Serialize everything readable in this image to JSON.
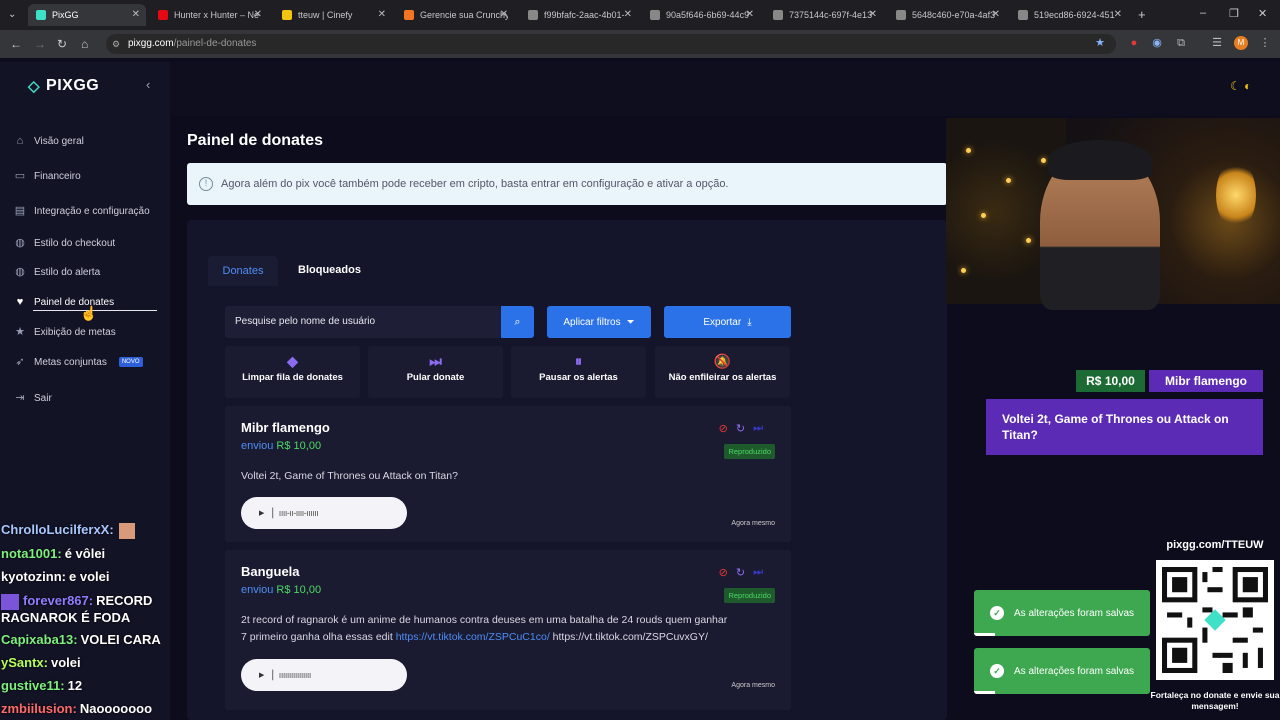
{
  "browser": {
    "tabs": [
      {
        "title": "PixGG",
        "active": true,
        "color": "#3ee0c8"
      },
      {
        "title": "Hunter x Hunter – Ne",
        "color": "#e50914"
      },
      {
        "title": "tteuw | Cinefy",
        "color": "#f1c40f"
      },
      {
        "title": "Gerencie sua Crunchy",
        "color": "#f47521"
      },
      {
        "title": "f99bfafc-2aac-4b01-",
        "color": "#888888"
      },
      {
        "title": "90a5f646-6b69-44c9",
        "color": "#888888"
      },
      {
        "title": "7375144c-697f-4e13",
        "color": "#888888"
      },
      {
        "title": "5648c460-e70a-4af3",
        "color": "#888888"
      },
      {
        "title": "519ecd86-6924-451",
        "color": "#888888"
      }
    ],
    "url_host": "pixgg.com",
    "url_path": "/painel-de-donates"
  },
  "sidebar": {
    "logo": "PIXGG",
    "items": [
      {
        "label": "Visão geral",
        "icon": "home-icon"
      },
      {
        "label": "Financeiro",
        "icon": "wallet-icon"
      },
      {
        "label": "Integração e configuração",
        "icon": "settings-icon"
      },
      {
        "label": "Estilo do checkout",
        "icon": "palette-icon"
      },
      {
        "label": "Estilo do alerta",
        "icon": "palette-icon"
      },
      {
        "label": "Painel de donates",
        "icon": "donate-icon",
        "active": true
      },
      {
        "label": "Exibição de metas",
        "icon": "star-icon"
      },
      {
        "label": "Metas conjuntas",
        "icon": "rocket-icon",
        "badge": "NOVO"
      },
      {
        "label": "Sair",
        "icon": "logout-icon"
      }
    ]
  },
  "chat": [
    {
      "user": "ChrolloLucilferxX:",
      "text": "",
      "color": "#a9c7ff"
    },
    {
      "user": "nota1001:",
      "text": "é vôlei",
      "color": "#7ef07e"
    },
    {
      "user": "kyotozinn:",
      "text": "e volei",
      "color": "#ffffff"
    },
    {
      "user": "forever867:",
      "text": "RECORD",
      "color": "#8f7dff"
    },
    {
      "user": "RAGNAROK É FODA",
      "text": "",
      "color": "#ffffff"
    },
    {
      "user": "Capixaba13:",
      "text": "VOLEI CARA",
      "color": "#7ef07e"
    },
    {
      "user": "ySantx:",
      "text": "volei",
      "color": "#b6ff5a"
    },
    {
      "user": "gustive11:",
      "text": "12",
      "color": "#7ef07e"
    },
    {
      "user": "zmbiilusion:",
      "text": "Naooooooo",
      "color": "#ff6b6b"
    }
  ],
  "main": {
    "title": "Painel de donates",
    "info": "Agora além do pix você também pode receber em cripto, basta entrar em configuração e ativar a opção.",
    "tabs": [
      "Donates",
      "Bloqueados"
    ],
    "search_placeholder": "Pesquise pelo nome de usuário",
    "filter_button": "Aplicar filtros",
    "export_button": "Exportar",
    "quick_actions": [
      {
        "label": "Limpar fila de donates",
        "icon": "eraser-icon"
      },
      {
        "label": "Pular donate",
        "icon": "skip-icon"
      },
      {
        "label": "Pausar os alertas",
        "icon": "pause-icon"
      },
      {
        "label": "Não enfileirar os alertas",
        "icon": "bell-off-icon"
      }
    ],
    "donates": [
      {
        "name": "Mibr flamengo",
        "sent_label": "enviou",
        "amount": "R$ 10,00",
        "status": "Reproduzido",
        "message": "Voltei 2t, Game of Thrones ou Attack on Titan?",
        "time": "Agora mesmo"
      },
      {
        "name": "Banguela",
        "sent_label": "enviou",
        "amount": "R$ 10,00",
        "status": "Reproduzido",
        "message_line1": "2t record of ragnarok é um anime de humanos contra deuses em uma batalha de 24 rouds quem ganhar",
        "message_line2_pre": "7 primeiro ganha olha essas edit ",
        "message_link": "https://vt.tiktok.com/ZSPCuC1co/",
        "message_line2_post": " https://vt.tiktok.com/ZSPCuvxGY/",
        "time": "Agora mesmo"
      }
    ]
  },
  "alert": {
    "amount": "R$ 10,00",
    "name": "Mibr flamengo",
    "message": "Voltei 2t, Game of Thrones ou Attack on Titan?"
  },
  "toasts": [
    {
      "text": "As alterações foram salvas",
      "progress": 0.12
    },
    {
      "text": "As alterações foram salvas",
      "progress": 0.12
    }
  ],
  "qr": {
    "url": "pixgg.com/TTEUW",
    "caption": "Fortaleça no donate e envie sua mensagem!"
  },
  "colors": {
    "accent": "#2b72e8",
    "brand": "#3ee0c8",
    "success": "#4cd964",
    "alert_purple": "#5c2bb6"
  }
}
